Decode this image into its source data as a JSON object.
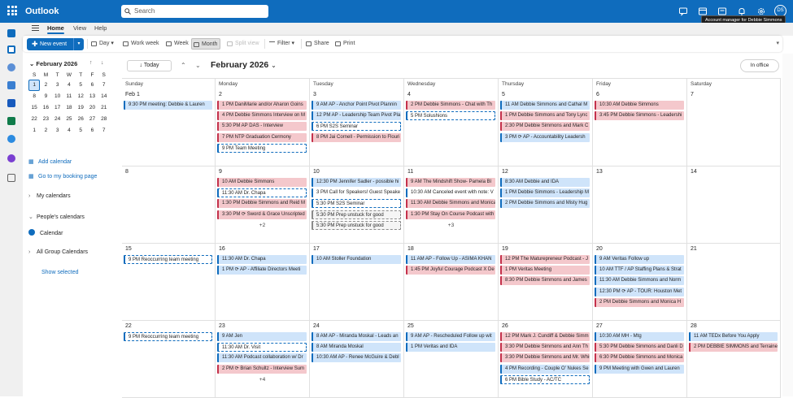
{
  "app": {
    "title": "Outlook",
    "search_placeholder": "Search",
    "avatar_initials": "DS",
    "tooltip": "Account manager for Debbie Simmons"
  },
  "tabs": {
    "home": "Home",
    "view": "View",
    "help": "Help"
  },
  "ribbon": {
    "new_event": "New event",
    "day": "Day",
    "work_week": "Work week",
    "week": "Week",
    "month": "Month",
    "split_view": "Split view",
    "filter": "Filter",
    "share": "Share",
    "print": "Print"
  },
  "mini_cal": {
    "title": "February 2026",
    "weekdays": [
      "S",
      "M",
      "T",
      "W",
      "T",
      "F",
      "S"
    ],
    "weeks": [
      [
        "1",
        "2",
        "3",
        "4",
        "5",
        "6",
        "7"
      ],
      [
        "8",
        "9",
        "10",
        "11",
        "12",
        "13",
        "14"
      ],
      [
        "15",
        "16",
        "17",
        "18",
        "19",
        "20",
        "21"
      ],
      [
        "22",
        "23",
        "24",
        "25",
        "26",
        "27",
        "28"
      ],
      [
        "1",
        "2",
        "3",
        "4",
        "5",
        "6",
        "7"
      ]
    ]
  },
  "sidebar": {
    "add_calendar": "Add calendar",
    "booking": "Go to my booking page",
    "my_calendars": "My calendars",
    "peoples_calendars": "People's calendars",
    "calendar": "Calendar",
    "all_group": "All Group Calendars",
    "show_selected": "Show selected"
  },
  "toolbar": {
    "today": "Today",
    "month_title": "February 2026",
    "in_office": "In office"
  },
  "colors": {
    "accent": "#0f6cbd",
    "pink_event": "#f4c8cc",
    "blue_event": "#cfe4fa"
  },
  "days_of_week": [
    "Sunday",
    "Monday",
    "Tuesday",
    "Wednesday",
    "Thursday",
    "Friday",
    "Saturday"
  ],
  "weeks": [
    {
      "days": [
        {
          "date": "Feb 1",
          "events": [
            {
              "t": "9:30 PM meeting: Debbie & Lauren",
              "c": "blue"
            }
          ]
        },
        {
          "date": "2",
          "events": [
            {
              "t": "1 PM DaniMarie and/or Aharon Goins",
              "c": "pink"
            },
            {
              "t": "4 PM Debbie Simmons Interview on M",
              "c": "pink"
            },
            {
              "t": "5:30 PM AP DAS - Interview",
              "c": "pink"
            },
            {
              "t": "7 PM NTP Graduation Cermony",
              "c": "pink"
            },
            {
              "t": "9 PM Team Meeting",
              "c": "dash"
            }
          ]
        },
        {
          "date": "3",
          "events": [
            {
              "t": "9 AM AP - Anchor Point Pivot Plannin",
              "c": "blue"
            },
            {
              "t": "12 PM AP - Leadership Team Pivot Pla",
              "c": "blue"
            },
            {
              "t": "6 PM S2S Seminar",
              "c": "dash"
            },
            {
              "t": "8 PM Jai Cornell - Permission to Flouri",
              "c": "pink"
            }
          ]
        },
        {
          "date": "4",
          "events": [
            {
              "t": "2 PM Debbie Simmons - Chat with Th",
              "c": "pink"
            },
            {
              "t": "5 PM Solushions",
              "c": "dash"
            }
          ]
        },
        {
          "date": "5",
          "events": [
            {
              "t": "11 AM Debbie Simmons and Cathal M",
              "c": "blue"
            },
            {
              "t": "1 PM Debbie Simmons and Tony Lync",
              "c": "pink"
            },
            {
              "t": "2:30 PM Debbie Simmons and Mark C",
              "c": "pink"
            },
            {
              "t": "3 PM ⟳ AP - Accountability Leadersh",
              "c": "blue"
            }
          ]
        },
        {
          "date": "6",
          "events": [
            {
              "t": "10:30 AM Debbie Simmons",
              "c": "pink"
            },
            {
              "t": "3:45 PM Debbie Simmons - Leadershi",
              "c": "pink"
            }
          ]
        },
        {
          "date": "7",
          "events": []
        }
      ]
    },
    {
      "days": [
        {
          "date": "8",
          "events": []
        },
        {
          "date": "9",
          "events": [
            {
              "t": "10 AM Debbie Simmons",
              "c": "pink"
            },
            {
              "t": "11:30 AM Dr. Chapa",
              "c": "dash"
            },
            {
              "t": "1:30 PM Debbie Simmons and Reid M",
              "c": "pink"
            },
            {
              "t": "3:30 PM ⟳ Sword & Grace Unscripted",
              "c": "pink"
            }
          ],
          "more": "+2"
        },
        {
          "date": "10",
          "events": [
            {
              "t": "12:30 PM Jennifer Sadler - possible hi",
              "c": "blue"
            },
            {
              "t": "3 PM Call for Speakers! Guest Speake",
              "c": "outline"
            },
            {
              "t": "5:30 PM S2S Seminar",
              "c": "dash"
            },
            {
              "t": "5:30 PM Prep unstuck for good",
              "c": "dashgrey"
            },
            {
              "t": "5:30 PM Prep unstuck for good",
              "c": "dashgrey"
            }
          ]
        },
        {
          "date": "11",
          "events": [
            {
              "t": "9 AM The Mindshift Show- Pamela Bl",
              "c": "pink"
            },
            {
              "t": "10:30 AM Canceled event with note: V",
              "c": "outline"
            },
            {
              "t": "11:30 AM Debbie Simmons and Monica",
              "c": "pink"
            },
            {
              "t": "1:30 PM Stay On Course Podcast with",
              "c": "pink"
            }
          ],
          "more": "+3"
        },
        {
          "date": "12",
          "events": [
            {
              "t": "8:30 AM Debbie and IDA",
              "c": "blue"
            },
            {
              "t": "1 PM Debbie Simmons - Leadership M",
              "c": "blue"
            },
            {
              "t": "2 PM Debbie Simmons and Misty Hug",
              "c": "blue"
            }
          ]
        },
        {
          "date": "13",
          "events": []
        },
        {
          "date": "14",
          "events": []
        }
      ]
    },
    {
      "days": [
        {
          "date": "15",
          "events": [
            {
              "t": "9 PM Reoccurring team meeting",
              "c": "dash"
            }
          ]
        },
        {
          "date": "16",
          "events": [
            {
              "t": "11:30 AM Dr. Chapa",
              "c": "blue"
            },
            {
              "t": "1 PM ⟳ AP - Affiliate Directors Meeti",
              "c": "blue"
            }
          ]
        },
        {
          "date": "17",
          "events": [
            {
              "t": "10 AM Stoller Foundation",
              "c": "blue"
            }
          ]
        },
        {
          "date": "18",
          "events": [
            {
              "t": "11 AM AP - Follow Up - ASIMA KHAN",
              "c": "blue"
            },
            {
              "t": "1:45 PM Joyful Courage Podcast X De",
              "c": "pink"
            }
          ]
        },
        {
          "date": "19",
          "events": [
            {
              "t": "12 PM The Maturepreneur Podcast - J",
              "c": "pink"
            },
            {
              "t": "1 PM Veritas Meeting",
              "c": "pink"
            },
            {
              "t": "8:30 PM Debbie Simmons and James",
              "c": "pink"
            }
          ]
        },
        {
          "date": "20",
          "events": [
            {
              "t": "9 AM Veritas Follow up",
              "c": "blue"
            },
            {
              "t": "10 AM TTF / AP Staffing Plans & Strat",
              "c": "blue"
            },
            {
              "t": "11:30 AM Debbie Simmons and Norm",
              "c": "blue"
            },
            {
              "t": "12:30 PM ⟳ AP - TOUR: Houston Met",
              "c": "blue"
            },
            {
              "t": "2 PM Debbie Simmons and Monica H",
              "c": "pink"
            }
          ]
        },
        {
          "date": "21",
          "events": []
        }
      ]
    },
    {
      "days": [
        {
          "date": "22",
          "events": [
            {
              "t": "9 PM Reoccurring team meeting",
              "c": "dash"
            }
          ]
        },
        {
          "date": "23",
          "events": [
            {
              "t": "9 AM Jen",
              "c": "blue"
            },
            {
              "t": "11:30 AM Dr. Visit",
              "c": "dash"
            },
            {
              "t": "11:30 AM Podcast collaboration w/ Dr",
              "c": "blue"
            },
            {
              "t": "2 PM ⟳ Brian Schultz - Interview Sum",
              "c": "pink"
            }
          ],
          "more": "+4"
        },
        {
          "date": "24",
          "events": [
            {
              "t": "8 AM AP - Miranda Moskal - Leads an",
              "c": "blue"
            },
            {
              "t": "8 AM Miranda Moskal",
              "c": "blue"
            },
            {
              "t": "10:30 AM AP - Renee McGuire & Debl",
              "c": "blue"
            }
          ]
        },
        {
          "date": "25",
          "events": [
            {
              "t": "9 AM AP - Rescheduled Follow up wit",
              "c": "blue"
            },
            {
              "t": "1 PM Veritas and IDA",
              "c": "blue"
            }
          ]
        },
        {
          "date": "26",
          "events": [
            {
              "t": "12 PM Mark J. Cundiff & Debbie Simm",
              "c": "pink"
            },
            {
              "t": "3:30 PM Debbie Simmons and Ann Th",
              "c": "pink"
            },
            {
              "t": "3:30 PM Debbie Simmons and Mr. Whisk",
              "c": "pink"
            },
            {
              "t": "4 PM Recording - Couple O' Nukes Se",
              "c": "blue"
            },
            {
              "t": "6 PM Bible Study - AC/TC",
              "c": "dash"
            }
          ]
        },
        {
          "date": "27",
          "events": [
            {
              "t": "10:30 AM MH - Mtg",
              "c": "blue"
            },
            {
              "t": "5:30 PM Debbie Simmons and Danli D",
              "c": "pink"
            },
            {
              "t": "6:30 PM Debbie Simmons and Monica",
              "c": "pink"
            },
            {
              "t": "9 PM Meeting with Gwen and Lauren",
              "c": "blue"
            }
          ]
        },
        {
          "date": "28",
          "events": [
            {
              "t": "11 AM TEDx Before You Apply",
              "c": "blue"
            },
            {
              "t": "2 PM DEBBIE SIMMONS and Terraine",
              "c": "pink"
            }
          ]
        }
      ]
    }
  ]
}
